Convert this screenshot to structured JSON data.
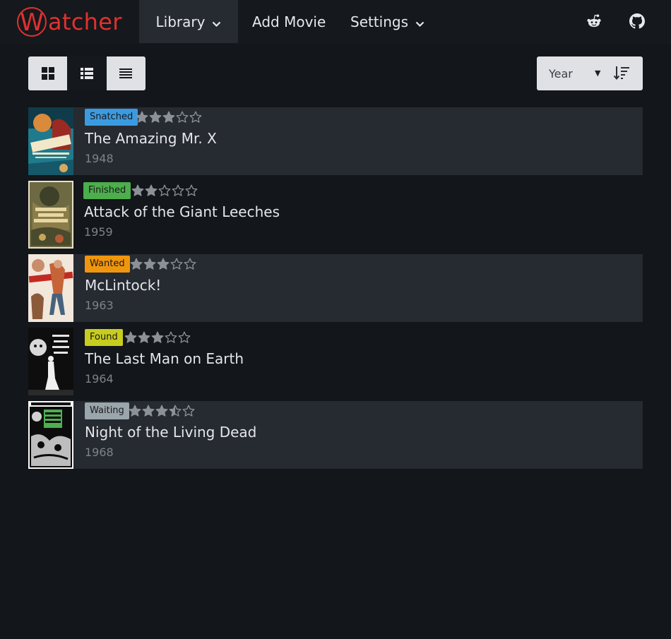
{
  "app": {
    "logo_letter": "W",
    "logo_rest": "atcher",
    "brand_color": "#e0312f"
  },
  "nav": {
    "library": "Library",
    "add_movie": "Add Movie",
    "settings": "Settings",
    "icons": [
      "reddit-icon",
      "github-icon"
    ]
  },
  "toolbar": {
    "views": [
      "grid-view-icon",
      "list-view-icon",
      "compact-view-icon"
    ],
    "active_view": "list-view-icon",
    "sort_by": "Year",
    "sort_direction_icon": "sort-ascending-icon"
  },
  "status_colors": {
    "Snatched": "#3b9be0",
    "Finished": "#4cae4c",
    "Wanted": "#f0960e",
    "Found": "#c8cc1f",
    "Waiting": "#9aa5ad"
  },
  "movies": [
    {
      "status": "Snatched",
      "title": "The Amazing Mr. X",
      "year": "1948",
      "rating": 3
    },
    {
      "status": "Finished",
      "title": "Attack of the Giant Leeches",
      "year": "1959",
      "rating": 2
    },
    {
      "status": "Wanted",
      "title": "McLintock!",
      "year": "1963",
      "rating": 3
    },
    {
      "status": "Found",
      "title": "The Last Man on Earth",
      "year": "1964",
      "rating": 3
    },
    {
      "status": "Waiting",
      "title": "Night of the Living Dead",
      "year": "1968",
      "rating": 3.5
    }
  ]
}
